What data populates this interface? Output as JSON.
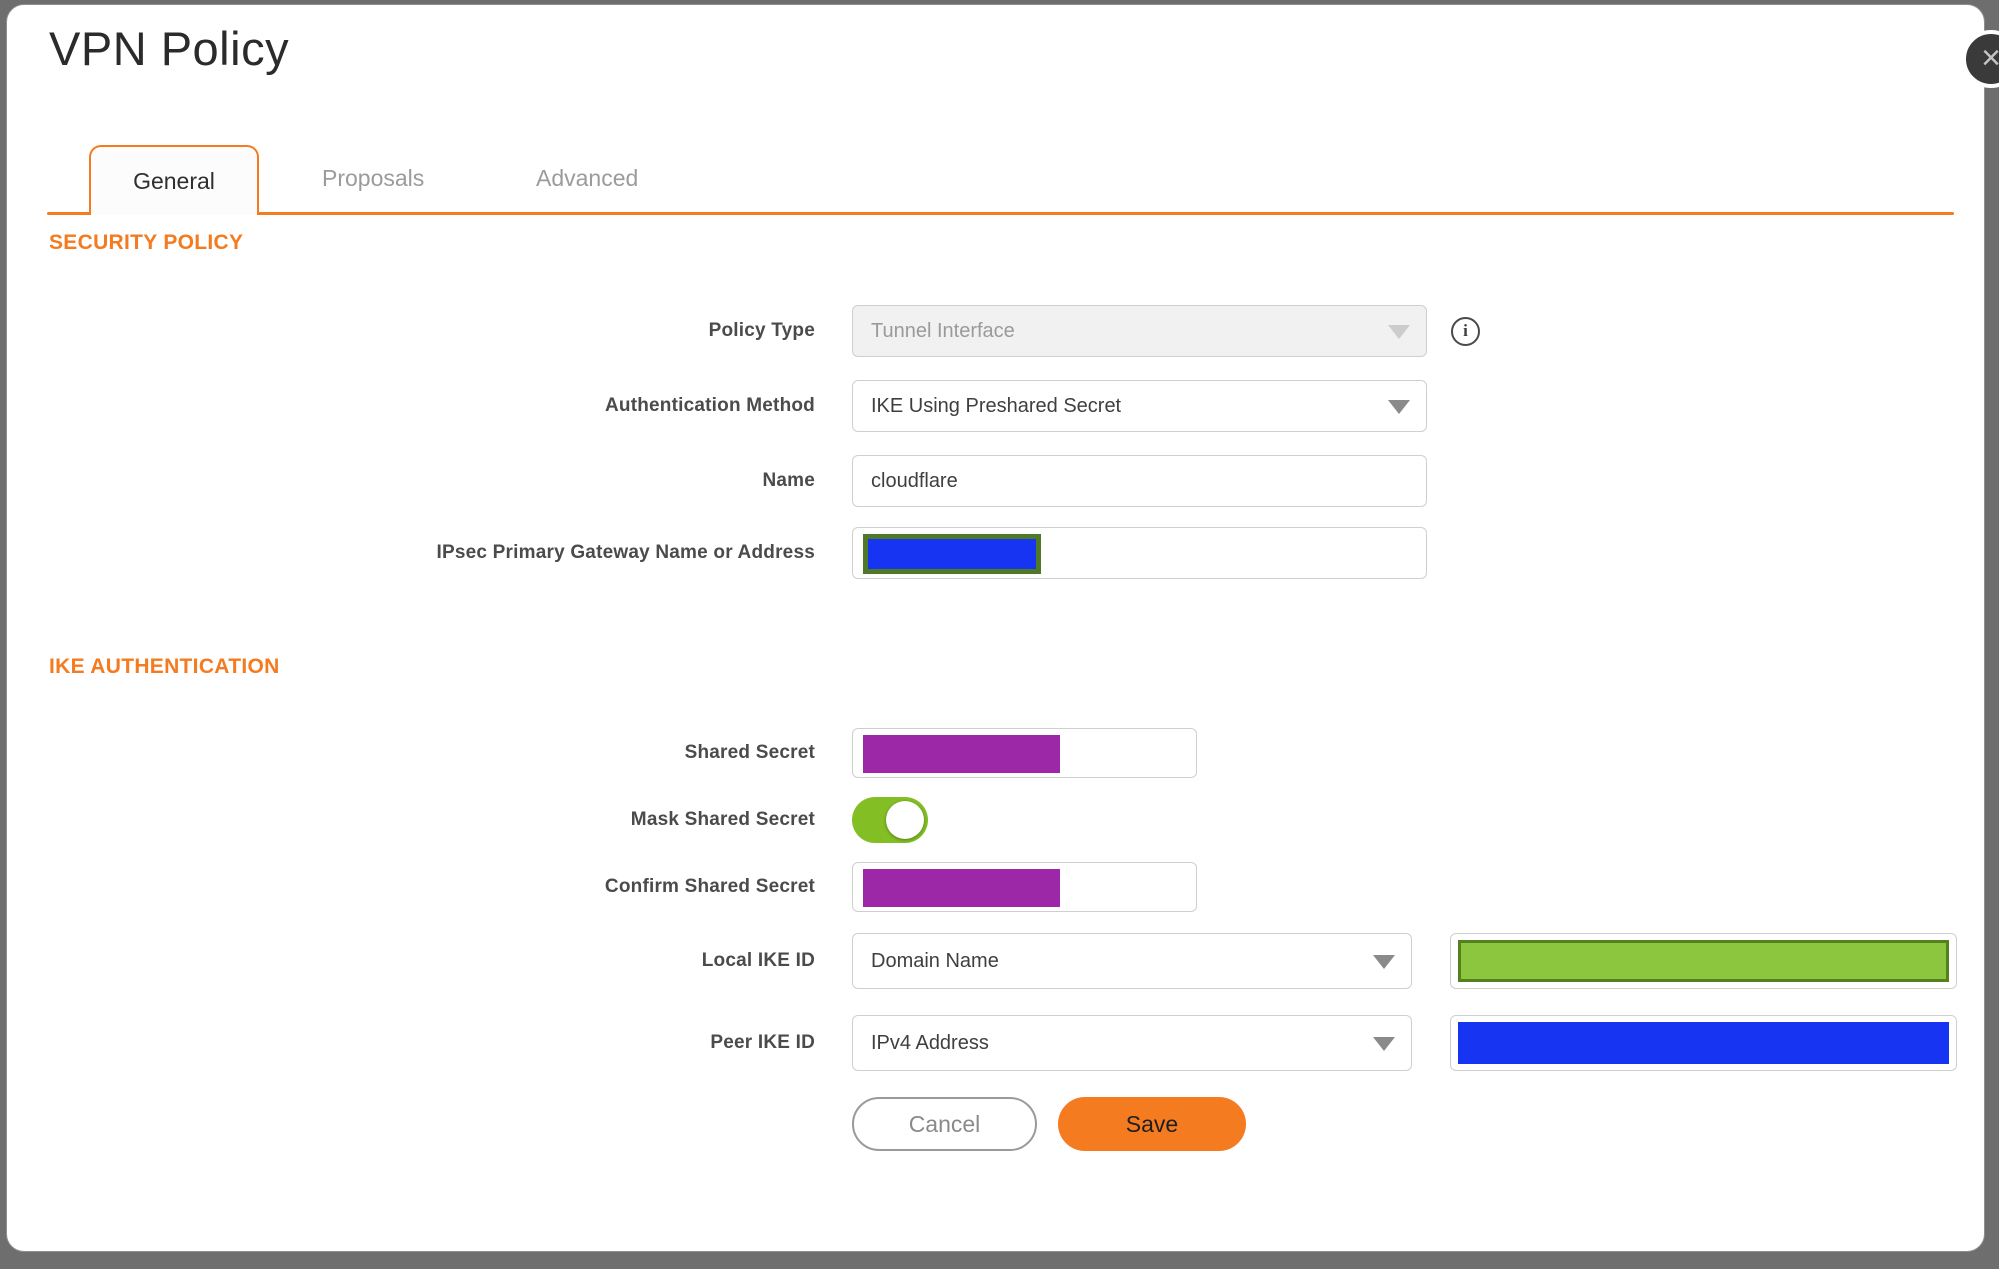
{
  "dialog": {
    "title": "VPN Policy"
  },
  "icons": {
    "close": "×",
    "info": "i"
  },
  "tabs": [
    {
      "label": "General",
      "active": true
    },
    {
      "label": "Proposals",
      "active": false
    },
    {
      "label": "Advanced",
      "active": false
    }
  ],
  "sections": [
    {
      "heading": "SECURITY POLICY"
    },
    {
      "heading": "IKE AUTHENTICATION"
    }
  ],
  "fields": {
    "policy_type": {
      "label": "Policy Type",
      "value": "Tunnel Interface",
      "disabled": true
    },
    "authentication_method": {
      "label": "Authentication Method",
      "value": "IKE Using Preshared Secret"
    },
    "name": {
      "label": "Name",
      "value": "cloudflare"
    },
    "ipsec_primary_gateway": {
      "label": "IPsec Primary Gateway Name or Address",
      "redacted": true
    },
    "shared_secret": {
      "label": "Shared Secret",
      "redacted": true
    },
    "mask_shared_secret": {
      "label": "Mask Shared Secret",
      "enabled": true
    },
    "confirm_shared_secret": {
      "label": "Confirm Shared Secret",
      "redacted": true
    },
    "local_ike_id": {
      "label": "Local IKE ID",
      "value": "Domain Name",
      "id_value_redacted": true
    },
    "peer_ike_id": {
      "label": "Peer IKE ID",
      "value": "IPv4 Address",
      "id_value_redacted": true
    }
  },
  "buttons": {
    "cancel": "Cancel",
    "save": "Save"
  },
  "colors": {
    "accent_orange": "#f47b20",
    "overlay_gray": "#6e6e6e",
    "redaction_purple": "#9c28a8",
    "redaction_blue": "#1734f2",
    "redaction_green_fill": "#8cc63f",
    "redaction_green_border": "#55801f",
    "gateway_border_olive": "#4e7a28",
    "toggle_green": "#82be24"
  }
}
